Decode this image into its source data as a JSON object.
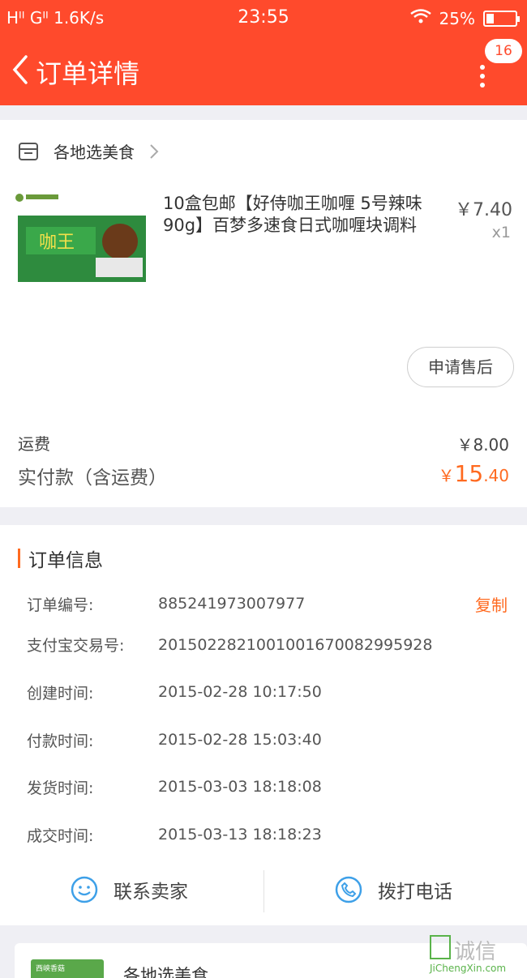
{
  "status_bar": {
    "left": "Hᴵᴵ Gᴵᴵ 1.6K/s",
    "time": "23:55",
    "battery": "25%"
  },
  "header": {
    "title": "订单详情",
    "badge": "16"
  },
  "shop": {
    "name": "各地选美食"
  },
  "product": {
    "title": "10盒包邮【好侍咖王咖喱 5号辣味90g】百梦多速食日式咖喱块调料",
    "price": "￥7.40",
    "qty": "x1",
    "image_label": "咖王"
  },
  "after_sale": "申请售后",
  "shipping": {
    "label": "运费",
    "value": "￥8.00"
  },
  "paid": {
    "label": "实付款（含运费）",
    "yen": "￥",
    "int": "15",
    "dec": ".40"
  },
  "order_info": {
    "title": "订单信息",
    "copy": "复制",
    "rows": [
      {
        "label": "订单编号:",
        "value": "885241973007977"
      },
      {
        "label": "支付宝交易号:",
        "value": "2015022821001001670082995928"
      },
      {
        "label": "创建时间:",
        "value": "2015-02-28 10:17:50"
      },
      {
        "label": "付款时间:",
        "value": "2015-02-28 15:03:40"
      },
      {
        "label": "发货时间:",
        "value": "2015-03-03 18:18:08"
      },
      {
        "label": "成交时间:",
        "value": "2015-03-13 18:18:23"
      }
    ]
  },
  "actions": {
    "contact": "联系卖家",
    "call": "拨打电话"
  },
  "next_card": {
    "shop": "各地选美食",
    "img_text": "西峡香菇"
  },
  "watermark": {
    "text": "诚信",
    "url": "JiChengXin.com"
  },
  "colors": {
    "header": "#ff4a2c",
    "accent": "#ff6a20"
  }
}
